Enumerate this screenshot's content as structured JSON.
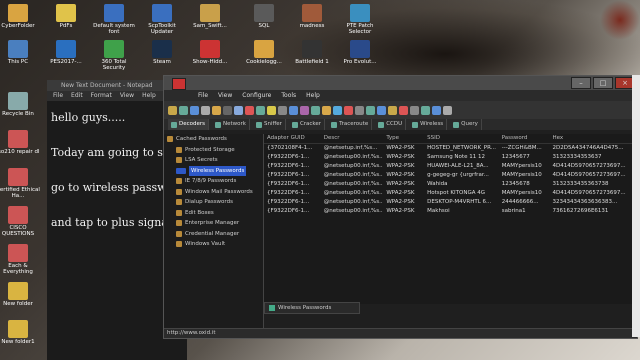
{
  "desktop": {
    "icons": [
      {
        "label": "CyberFolder"
      },
      {
        "label": "PdFs"
      },
      {
        "label": "Default system font"
      },
      {
        "label": "ScpToolkit Updater"
      },
      {
        "label": "Sam_Swift..."
      },
      {
        "label": "SQL"
      },
      {
        "label": "madness"
      },
      {
        "label": "PTE Patch Selector"
      },
      {
        "label": "This PC"
      },
      {
        "label": "PES2017-..."
      },
      {
        "label": "360 Total Security"
      },
      {
        "label": "Steam"
      },
      {
        "label": "Show-Hidd..."
      },
      {
        "label": "Cookielogg..."
      },
      {
        "label": "Battlefield 1"
      },
      {
        "label": "Pro Evolut..."
      },
      {
        "label": "Recycle Bin"
      },
      {
        "label": "iso210 repair dl"
      },
      {
        "label": "Certified Ethical Ha..."
      },
      {
        "label": "CISCO QUESTIONS"
      },
      {
        "label": "Each & Everything"
      },
      {
        "label": "New folder"
      },
      {
        "label": "New folder1"
      }
    ]
  },
  "notepad": {
    "title": "New Text Document - Notepad",
    "menu": [
      "File",
      "Edit",
      "Format",
      "View",
      "Help"
    ],
    "lines": [
      "hello guys.....",
      "Today am going to sho",
      "go to wireless passwor",
      "and tap to plus signal"
    ]
  },
  "cain": {
    "menu": [
      "File",
      "View",
      "Configure",
      "Tools",
      "Help"
    ],
    "tabs": [
      "Decoders",
      "Network",
      "Sniffer",
      "Cracker",
      "Traceroute",
      "CCDU",
      "Wireless",
      "Query"
    ],
    "active_tab": "Decoders",
    "tree": [
      {
        "label": "Cached Passwords",
        "root": true
      },
      {
        "label": "Protected Storage"
      },
      {
        "label": "LSA Secrets"
      },
      {
        "label": "Wireless Passwords",
        "selected": true
      },
      {
        "label": "IE 7/8/9 Passwords"
      },
      {
        "label": "Windows Mail Passwords"
      },
      {
        "label": "Dialup Passwords"
      },
      {
        "label": "Edit Boxes"
      },
      {
        "label": "Enterprise Manager"
      },
      {
        "label": "Credential Manager"
      },
      {
        "label": "Windows Vault"
      }
    ],
    "columns": [
      "Adapter GUID",
      "Descr",
      "Type",
      "SSID",
      "Password",
      "Hex"
    ],
    "rows": [
      [
        "{3702108F4-1...",
        "@netsetup.inf,%s...",
        "WPA2-PSK",
        "HOSTED_NETWORK_PR...",
        "---ZCGH&BM...",
        "2D2D5A434746A4D475..."
      ],
      [
        "{F9322DF6-1...",
        "@netsetup00.inf,%s...",
        "WPA2-PSK",
        "Samsung Note 11 12",
        "12345677",
        "31323334353637"
      ],
      [
        "{F9322DF6-1...",
        "@netsetup00.inf,%s...",
        "WPA2-PSK",
        "HUAWEI-ALE-L21_8A...",
        "MAMYpersis10",
        "4D414D5970657273697..."
      ],
      [
        "{F9322DF6-1...",
        "@netsetup00.inf,%s...",
        "WPA2-PSK",
        "g-gegeg-gr {urgrfrar...",
        "MAMYpersis10",
        "4D414D5970657273697..."
      ],
      [
        "{F9322DF6-1...",
        "@netsetup00.inf,%s...",
        "WPA2-PSK",
        "Wahida",
        "12345678",
        "3132333435363738"
      ],
      [
        "{F9322DF6-1...",
        "@netsetup00.inf,%s...",
        "WPA2-PSK",
        "Hotspot KITONGA 4G",
        "MAMYpersis10",
        "4D414D5970657273697..."
      ],
      [
        "{F9322DF6-1...",
        "@netsetup00.inf,%s...",
        "WPA2-PSK",
        "DESKTOP-M4VRHTL 6...",
        "244466666...",
        "32343434363636383..."
      ],
      [
        "{F9322DF6-1...",
        "@netsetup00.inf,%s...",
        "WPA2-PSK",
        "Makhsoi",
        "sabrina1",
        "73616272696E6131"
      ]
    ],
    "bottom_tab": "Wireless Passwords",
    "status": "http://www.oxid.it"
  },
  "colors": {
    "selected": "#2d58c8",
    "close": "#a8362b"
  }
}
